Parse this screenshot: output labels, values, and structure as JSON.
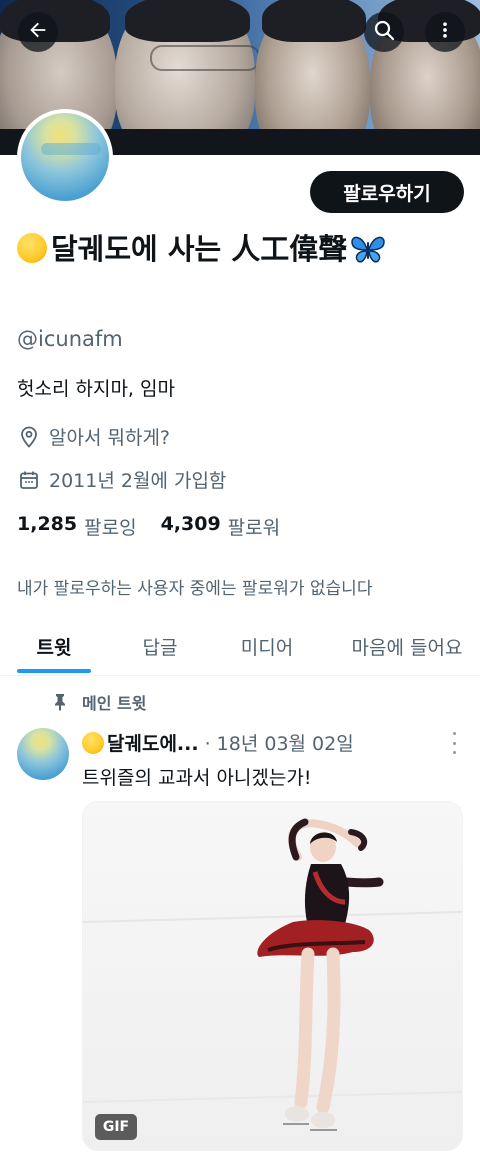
{
  "header": {
    "back_icon": "arrow-left-icon",
    "search_icon": "search-icon",
    "more_icon": "more-vertical-icon"
  },
  "profile": {
    "follow_label": "팔로우하기",
    "display_name": "달궤도에 사는 人工偉聲",
    "handle": "@icunafm",
    "bio": "헛소리 하지마, 임마",
    "location": "알아서 뭐하게?",
    "joined": "2011년 2월에 가입함",
    "following_count": "1,285",
    "following_label": "팔로잉",
    "followers_count": "4,309",
    "followers_label": "팔로워",
    "followed_by": "내가 팔로우하는 사용자 중에는 팔로워가 없습니다"
  },
  "tabs": [
    {
      "label": "트윗",
      "active": true
    },
    {
      "label": "답글",
      "active": false
    },
    {
      "label": "미디어",
      "active": false
    },
    {
      "label": "마음에 들어요",
      "active": false
    }
  ],
  "pinned_tweet": {
    "pinned_label": "메인 트윗",
    "author_name": "달궤도에...",
    "date": "· 18년 03월 02일",
    "text": "트위즐의 교과서 아니겠는가!",
    "media_badge": "GIF"
  },
  "colors": {
    "accent": "#1d9bf0",
    "text_primary": "#0f1419",
    "text_secondary": "#536471",
    "button_dark": "#0f1419"
  }
}
